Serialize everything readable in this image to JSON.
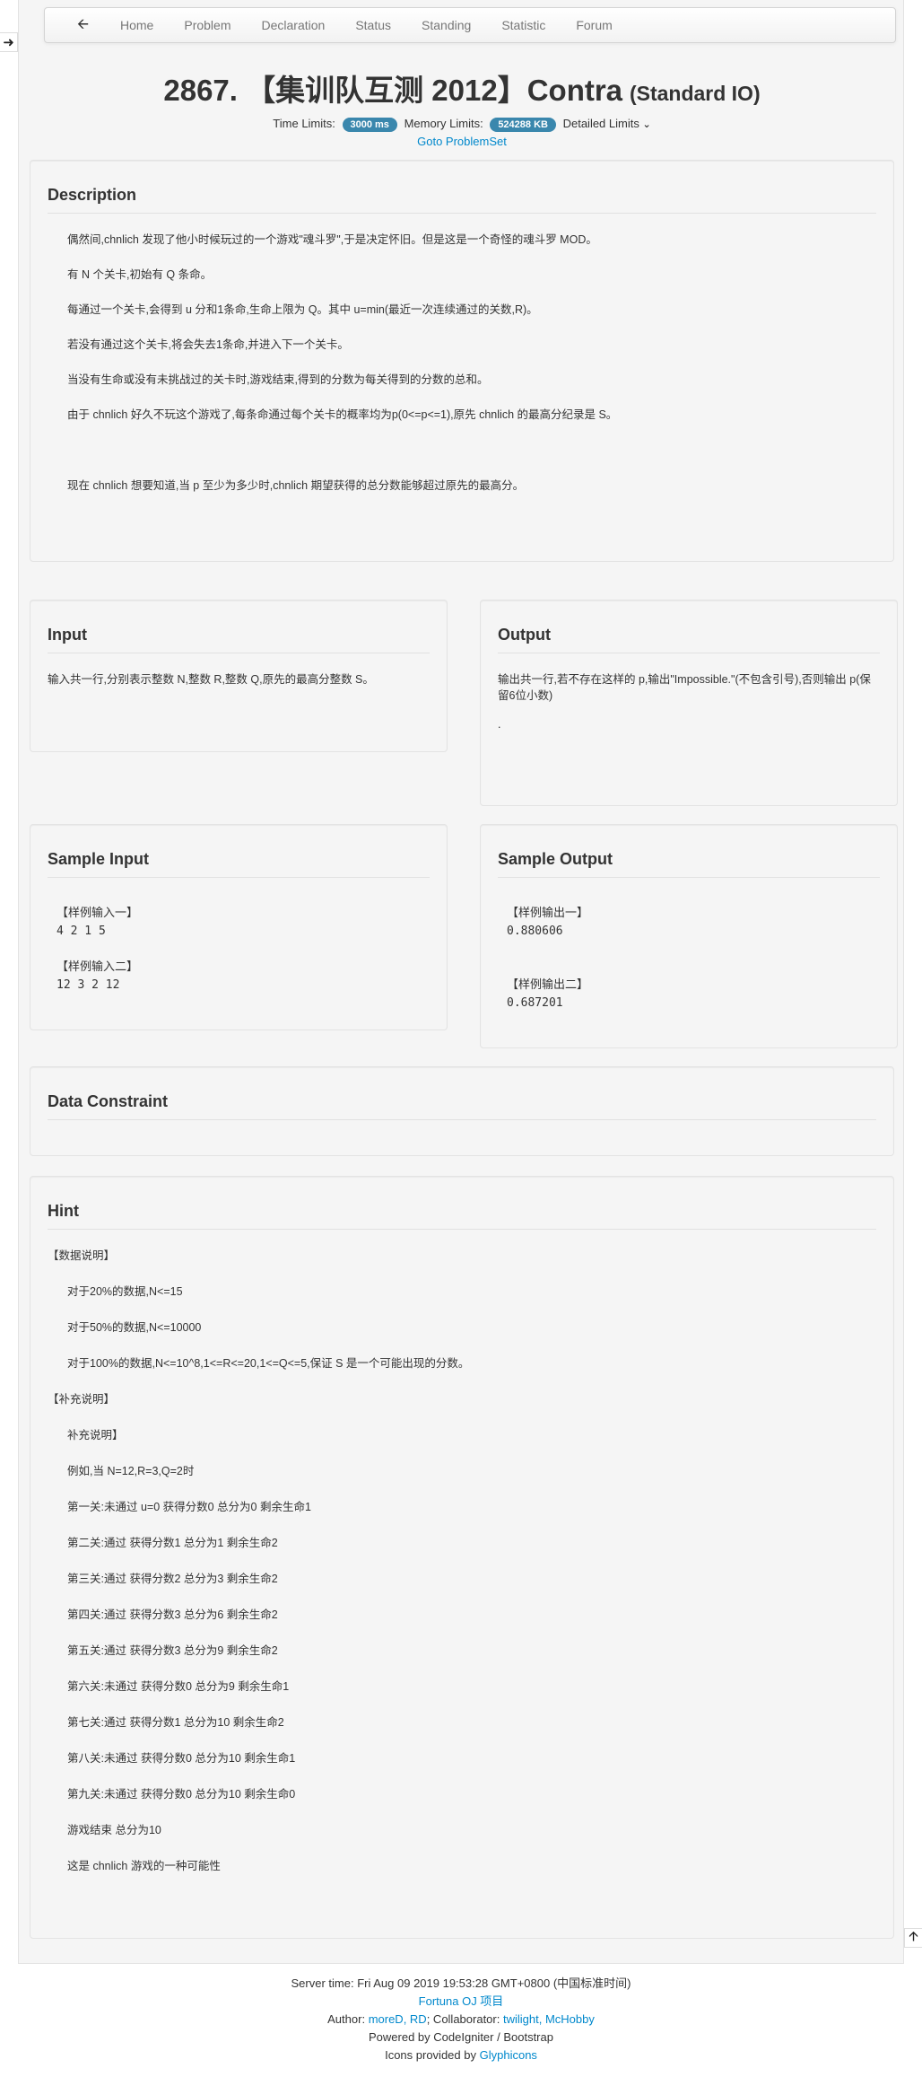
{
  "nav": {
    "back_icon": "arrow-left-icon",
    "items": [
      "Home",
      "Problem",
      "Declaration",
      "Status",
      "Standing",
      "Statistic",
      "Forum"
    ]
  },
  "problem": {
    "title": "2867. 【集训队互测 2012】Contra",
    "io_type": "(Standard IO)",
    "time_label": "Time Limits:",
    "time_value": "3000 ms",
    "memory_label": "Memory Limits:",
    "memory_value": "524288 KB",
    "detailed_label": "Detailed Limits",
    "goto": "Goto ProblemSet"
  },
  "description": {
    "title": "Description",
    "paragraphs": [
      "偶然间,chnlich 发现了他小时候玩过的一个游戏\"魂斗罗\",于是决定怀旧。但是这是一个奇怪的魂斗罗 MOD。",
      "有 N 个关卡,初始有 Q 条命。",
      "每通过一个关卡,会得到 u 分和1条命,生命上限为 Q。其中 u=min(最近一次连续通过的关数,R)。",
      "若没有通过这个关卡,将会失去1条命,并进入下一个关卡。",
      "当没有生命或没有未挑战过的关卡时,游戏结束,得到的分数为每关得到的分数的总和。",
      "由于 chnlich 好久不玩这个游戏了,每条命通过每个关卡的概率均为p(0<=p<=1),原先 chnlich 的最高分纪录是 S。",
      "现在 chnlich 想要知道,当 p 至少为多少时,chnlich 期望获得的总分数能够超过原先的最高分。"
    ]
  },
  "input": {
    "title": "Input",
    "text": "输入共一行,分别表示整数 N,整数 R,整数 Q,原先的最高分整数 S。"
  },
  "output": {
    "title": "Output",
    "text": "输出共一行,若不存在这样的 p,输出\"Impossible.\"(不包含引号),否则输出 p(保留6位小数)",
    "extra": "."
  },
  "sample_input": {
    "title": "Sample Input",
    "lines": [
      "【样例输入一】",
      "4 2 1 5",
      "",
      "【样例输入二】",
      "12 3 2 12"
    ]
  },
  "sample_output": {
    "title": "Sample Output",
    "lines": [
      "【样例输出一】",
      "0.880606",
      "",
      "",
      "【样例输出二】",
      "0.687201"
    ]
  },
  "constraint": {
    "title": "Data Constraint"
  },
  "hint": {
    "title": "Hint",
    "head1": "【数据说明】",
    "data_lines": [
      "对于20%的数据,N<=15",
      "对于50%的数据,N<=10000",
      "对于100%的数据,N<=10^8,1<=R<=20,1<=Q<=5,保证 S 是一个可能出现的分数。"
    ],
    "head2": "【补充说明】",
    "extra_lines": [
      "补充说明】",
      "例如,当 N=12,R=3,Q=2时",
      "第一关:未通过 u=0 获得分数0 总分为0 剩余生命1",
      "第二关:通过 获得分数1 总分为1 剩余生命2",
      "第三关:通过 获得分数2 总分为3 剩余生命2",
      "第四关:通过 获得分数3 总分为6 剩余生命2",
      "第五关:通过 获得分数3 总分为9 剩余生命2",
      "第六关:未通过 获得分数0 总分为9 剩余生命1",
      "第七关:通过 获得分数1 总分为10 剩余生命2",
      "第八关:未通过 获得分数0 总分为10 剩余生命1",
      "第九关:未通过 获得分数0 总分为10 剩余生命0",
      "游戏结束 总分为10",
      "这是 chnlich 游戏的一种可能性"
    ]
  },
  "footer": {
    "server_time": "Server time: Fri Aug 09 2019 19:53:28 GMT+0800 (中国标准时间)",
    "project": "Fortuna OJ 项目",
    "author_label": "Author:",
    "authors": "moreD, RD",
    "collab_label": "; Collaborator:",
    "collaborators": "twilight, McHobby",
    "powered": "Powered by CodeIgniter / Bootstrap",
    "icons_label": "Icons provided by",
    "icons_link": "Glyphicons"
  }
}
